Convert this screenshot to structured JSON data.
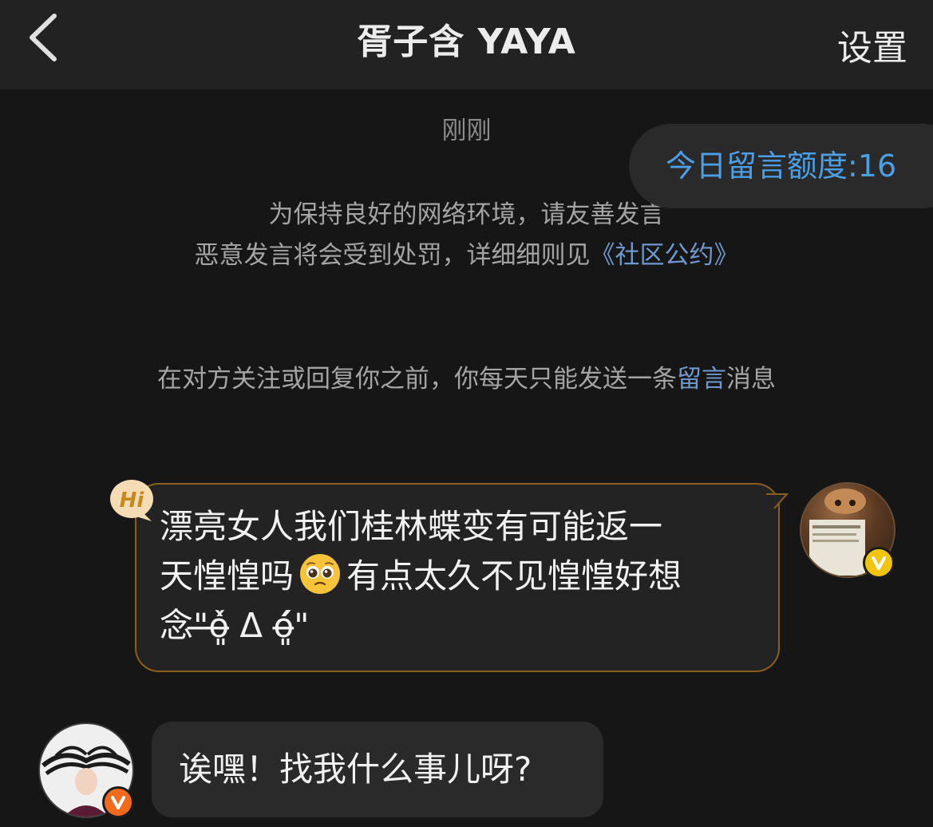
{
  "header": {
    "title": "胥子含 YAYA",
    "settings_label": "设置"
  },
  "conversation": {
    "timestamp": "刚刚",
    "quota_label": "今日留言额度:16",
    "notice_line1": "为保持良好的网络环境，请友善发言",
    "notice_line2_prefix": "恶意发言将会受到处罚，详细细则见",
    "notice_link": "《社区公约》",
    "notice_line3_prefix": "在对方关注或回复你之前，你每天只能发送一条",
    "notice_line3_link": "留言",
    "notice_line3_suffix": "消息"
  },
  "messages": [
    {
      "side": "right",
      "badge": "Hi",
      "text_line1": "漂亮女人我们桂林蝶变有可能返一",
      "text_line2_a": "天惶惶吗",
      "emoji": "pleading-face",
      "text_line2_b": "有点太久不见惶惶好想",
      "text_line3": "念\"̶ó̶͈̀ ᐃ ó̶͈́\"",
      "avatar_badge": "V"
    },
    {
      "side": "left",
      "text": "诶嘿！找我什么事儿呀?",
      "avatar_badge": "V"
    }
  ],
  "colors": {
    "background": "#161616",
    "header": "#222222",
    "link": "#6e99cf",
    "quota": "#4b9fe6",
    "bubble_border": "#8c5e1b",
    "badge_gold": "#f2c40c",
    "badge_orange": "#f26b1c"
  }
}
